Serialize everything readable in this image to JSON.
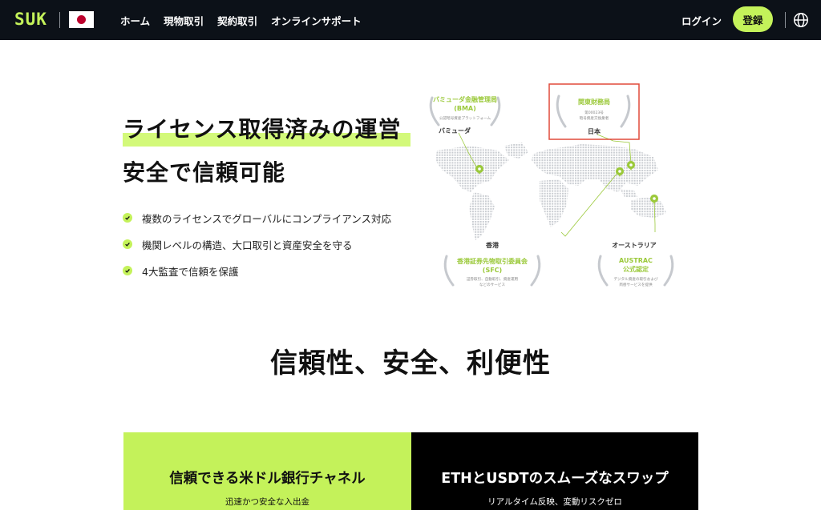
{
  "header": {
    "logo": "SUK",
    "nav": [
      "ホーム",
      "現物取引",
      "契約取引",
      "オンラインサポート"
    ],
    "login_label": "ログイン",
    "register_label": "登録"
  },
  "hero": {
    "title_line1": "ライセンス取得済みの運営",
    "title_line2": "安全で信頼可能",
    "features": [
      "複数のライセンスでグローバルにコンプライアンス対応",
      "機関レベルの構造、大口取引と資産安全を守る",
      "4大監査で信頼を保護"
    ]
  },
  "map": {
    "bermuda": {
      "name": "バミューダ金融管理局",
      "abbr": "(BMA)",
      "desc": "公認暗号資産プラットフォーム",
      "place": "バミューダ"
    },
    "japan": {
      "name": "関東財務局",
      "desc1": "第00023号",
      "desc2": "暗号資産交換業者",
      "place": "日本"
    },
    "hongkong": {
      "name": "香港証券先物取引委員会",
      "abbr": "(SFC)",
      "desc1": "証券取引、自動取引、資産運用",
      "desc2": "などのサービス",
      "place": "香港"
    },
    "australia": {
      "name": "AUSTRAC",
      "abbr": "公式認定",
      "desc1": "デジタル資産の取引および",
      "desc2": "両替サービスを提供",
      "place": "オーストラリア"
    },
    "highlight_color": "#e04a3a",
    "accent_color": "#9bc93a"
  },
  "section": {
    "title": "信頼性、安全、利便性"
  },
  "cards": [
    {
      "title": "信頼できる米ドル銀行チャネル",
      "subtitle": "迅速かつ安全な入出金"
    },
    {
      "title": "ETHとUSDTのスムーズなスワップ",
      "subtitle": "リアルタイム反映、変動リスクゼロ"
    }
  ],
  "colors": {
    "accent": "#c4f25a",
    "nav_bg": "#0c1118"
  }
}
